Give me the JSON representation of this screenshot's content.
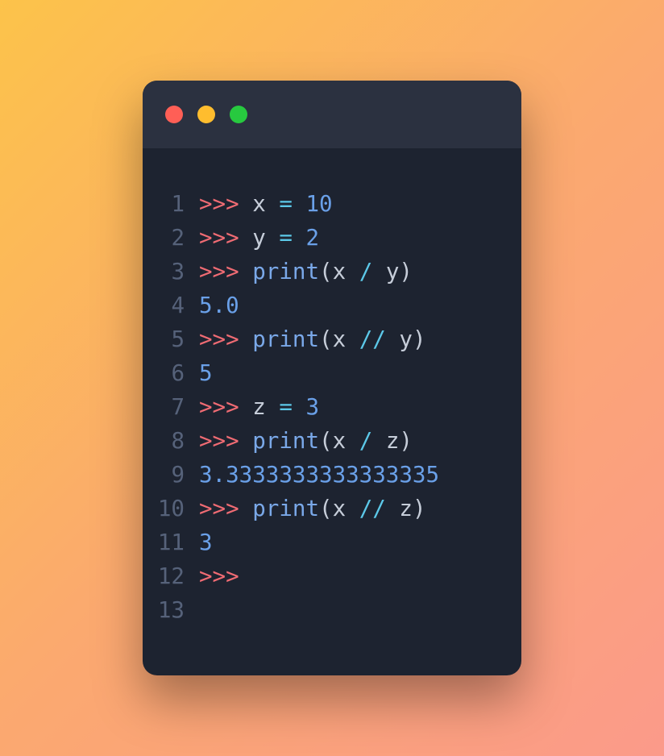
{
  "window": {
    "dots": [
      "red",
      "yellow",
      "green"
    ]
  },
  "code": {
    "lines": [
      {
        "n": "1",
        "tokens": [
          {
            "c": "prompt",
            "t": ">>>"
          },
          {
            "c": null,
            "t": " "
          },
          {
            "c": "ident",
            "t": "x"
          },
          {
            "c": null,
            "t": " "
          },
          {
            "c": "op",
            "t": "="
          },
          {
            "c": null,
            "t": " "
          },
          {
            "c": "num",
            "t": "10"
          }
        ]
      },
      {
        "n": "2",
        "tokens": [
          {
            "c": "prompt",
            "t": ">>>"
          },
          {
            "c": null,
            "t": " "
          },
          {
            "c": "ident",
            "t": "y"
          },
          {
            "c": null,
            "t": " "
          },
          {
            "c": "op",
            "t": "="
          },
          {
            "c": null,
            "t": " "
          },
          {
            "c": "num",
            "t": "2"
          }
        ]
      },
      {
        "n": "3",
        "tokens": [
          {
            "c": "prompt",
            "t": ">>>"
          },
          {
            "c": null,
            "t": " "
          },
          {
            "c": "func",
            "t": "print"
          },
          {
            "c": "paren",
            "t": "("
          },
          {
            "c": "ident",
            "t": "x"
          },
          {
            "c": null,
            "t": " "
          },
          {
            "c": "op",
            "t": "/"
          },
          {
            "c": null,
            "t": " "
          },
          {
            "c": "ident",
            "t": "y"
          },
          {
            "c": "paren",
            "t": ")"
          }
        ]
      },
      {
        "n": "4",
        "tokens": [
          {
            "c": "out",
            "t": "5.0"
          }
        ]
      },
      {
        "n": "5",
        "tokens": [
          {
            "c": "prompt",
            "t": ">>>"
          },
          {
            "c": null,
            "t": " "
          },
          {
            "c": "func",
            "t": "print"
          },
          {
            "c": "paren",
            "t": "("
          },
          {
            "c": "ident",
            "t": "x"
          },
          {
            "c": null,
            "t": " "
          },
          {
            "c": "op",
            "t": "//"
          },
          {
            "c": null,
            "t": " "
          },
          {
            "c": "ident",
            "t": "y"
          },
          {
            "c": "paren",
            "t": ")"
          }
        ]
      },
      {
        "n": "6",
        "tokens": [
          {
            "c": "out",
            "t": "5"
          }
        ]
      },
      {
        "n": "7",
        "tokens": [
          {
            "c": "prompt",
            "t": ">>>"
          },
          {
            "c": null,
            "t": " "
          },
          {
            "c": "ident",
            "t": "z"
          },
          {
            "c": null,
            "t": " "
          },
          {
            "c": "op",
            "t": "="
          },
          {
            "c": null,
            "t": " "
          },
          {
            "c": "num",
            "t": "3"
          }
        ]
      },
      {
        "n": "8",
        "tokens": [
          {
            "c": "prompt",
            "t": ">>>"
          },
          {
            "c": null,
            "t": " "
          },
          {
            "c": "func",
            "t": "print"
          },
          {
            "c": "paren",
            "t": "("
          },
          {
            "c": "ident",
            "t": "x"
          },
          {
            "c": null,
            "t": " "
          },
          {
            "c": "op",
            "t": "/"
          },
          {
            "c": null,
            "t": " "
          },
          {
            "c": "ident",
            "t": "z"
          },
          {
            "c": "paren",
            "t": ")"
          }
        ]
      },
      {
        "n": "9",
        "tokens": [
          {
            "c": "out",
            "t": "3.3333333333333335"
          }
        ]
      },
      {
        "n": "10",
        "tokens": [
          {
            "c": "prompt",
            "t": ">>>"
          },
          {
            "c": null,
            "t": " "
          },
          {
            "c": "func",
            "t": "print"
          },
          {
            "c": "paren",
            "t": "("
          },
          {
            "c": "ident",
            "t": "x"
          },
          {
            "c": null,
            "t": " "
          },
          {
            "c": "op",
            "t": "//"
          },
          {
            "c": null,
            "t": " "
          },
          {
            "c": "ident",
            "t": "z"
          },
          {
            "c": "paren",
            "t": ")"
          }
        ]
      },
      {
        "n": "11",
        "tokens": [
          {
            "c": "out",
            "t": "3"
          }
        ]
      },
      {
        "n": "12",
        "tokens": [
          {
            "c": "prompt",
            "t": ">>>"
          }
        ]
      },
      {
        "n": "13",
        "tokens": []
      }
    ]
  }
}
